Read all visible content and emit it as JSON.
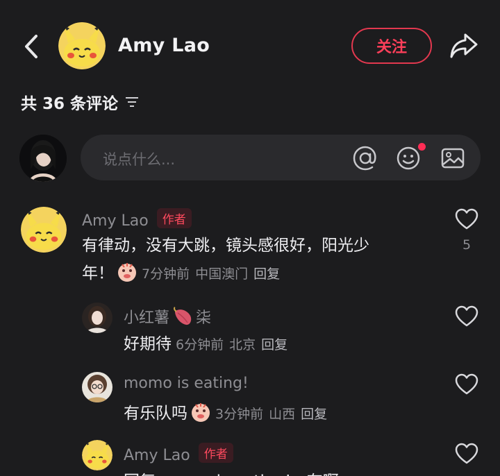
{
  "header": {
    "user_name": "Amy Lao",
    "follow_label": "关注"
  },
  "comments_summary": {
    "count_text": "共 36 条评论"
  },
  "composer": {
    "placeholder": "说点什么..."
  },
  "comments": [
    {
      "name": "Amy Lao",
      "badge": "作者",
      "text_line1": "有律动，没有大跳，镜头感很好，阳光少",
      "text_line2": "年！",
      "time": "7分钟前",
      "location": "中国澳门",
      "reply_label": "回复",
      "likes": "5"
    },
    {
      "name_prefix": "小红薯",
      "name_suffix": "柒",
      "text": "好期待",
      "time": "6分钟前",
      "location": "北京",
      "reply_label": "回复"
    },
    {
      "name": "momo is eating!",
      "text": "有乐队吗",
      "time": "3分钟前",
      "location": "山西",
      "reply_label": "回复"
    },
    {
      "name": "Amy Lao",
      "badge": "作者",
      "text": "回复 momo is eating! : 有啊"
    }
  ],
  "colors": {
    "background": "#1c1c1e",
    "accent": "#ff3f5a",
    "secondary_text": "#8e8e93"
  },
  "icons": [
    "back-icon",
    "share-icon",
    "filter-icon",
    "at-icon",
    "emoji-icon",
    "image-icon",
    "heart-icon"
  ]
}
